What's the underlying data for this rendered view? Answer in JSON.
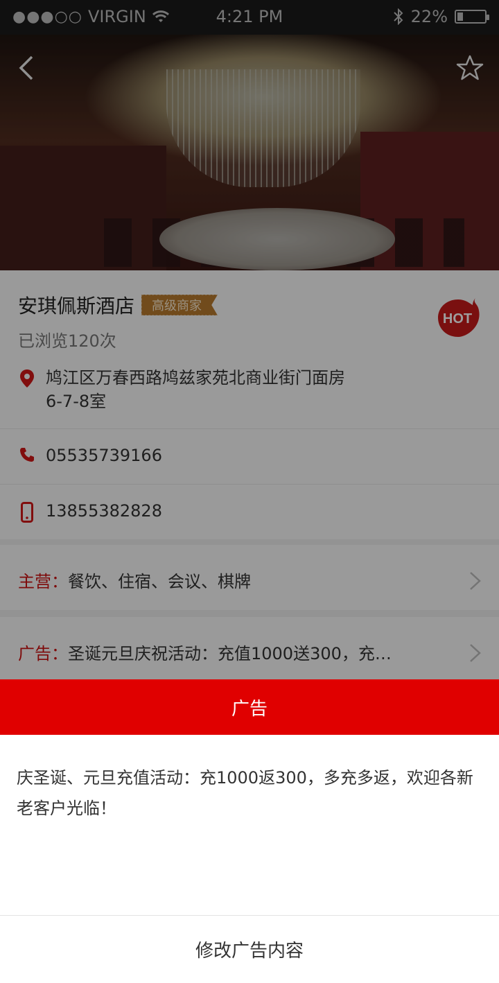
{
  "status_bar": {
    "signal_dots": "●●●○○",
    "carrier": "VIRGIN",
    "time": "4:21 PM",
    "battery_text": "22%",
    "battery_level": 0.22
  },
  "header": {
    "back_icon": "chevron-left-icon",
    "favorite_icon": "star-outline-icon"
  },
  "business": {
    "name": "安琪佩斯酒店",
    "badge": "高级商家",
    "views": "已浏览120次",
    "hot_label": "HOT",
    "address_line1": "鸠江区万春西路鸠兹家苑北商业街门面房",
    "address_line2": "6-7-8室",
    "phone": "05535739166",
    "mobile": "13855382828"
  },
  "sections": {
    "main_business": {
      "label": "主营：",
      "value": "餐饮、住宿、会议、棋牌"
    },
    "advertisement": {
      "label": "广告：",
      "value": "圣诞元旦庆祝活动：充值1000送300，充…"
    }
  },
  "modal": {
    "title": "广告",
    "body": "庆圣诞、元旦充值活动：充1000返300，多充多返，欢迎各新老客户光临！",
    "action": "修改广告内容"
  },
  "colors": {
    "accent_red": "#e00000",
    "label_red": "#c11",
    "badge_gold": "#b77a2e"
  }
}
